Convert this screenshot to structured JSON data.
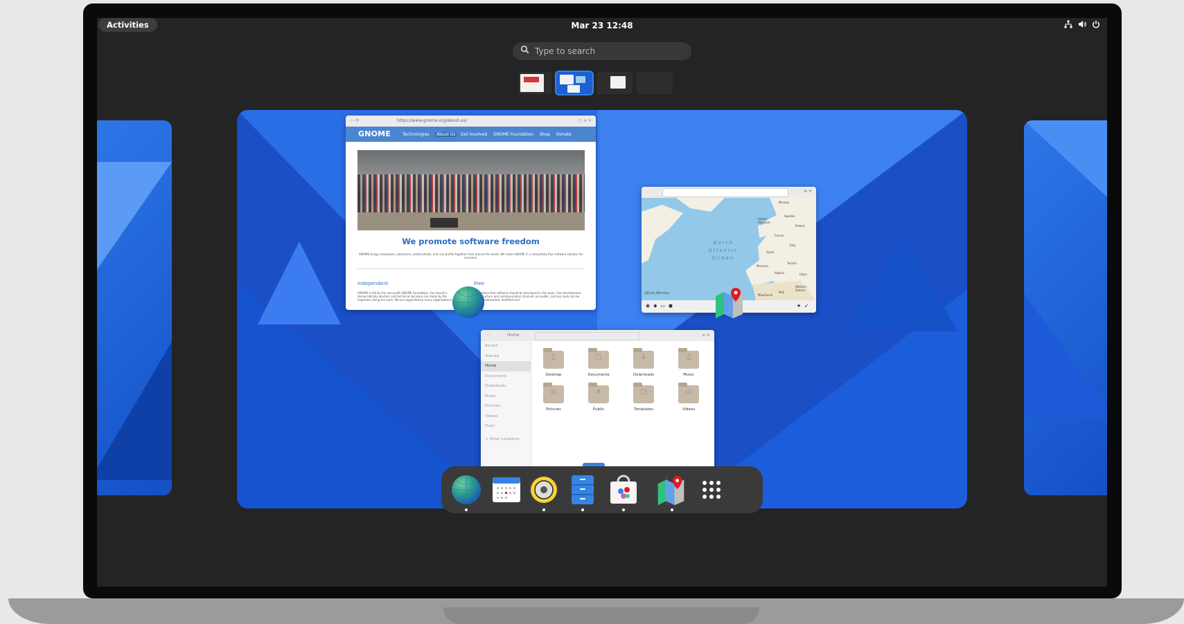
{
  "topbar": {
    "activities_label": "Activities",
    "clock": "Mar 23  12:48",
    "tray_icons": [
      "network-icon",
      "volume-icon",
      "power-icon"
    ]
  },
  "search": {
    "placeholder": "Type to search"
  },
  "workspaces": {
    "count": 4,
    "active_index": 1
  },
  "windows": {
    "web": {
      "url": "https://www.gnome.org/about-us/",
      "brand": "GNOME",
      "nav": [
        "Technologies",
        "About Us",
        "Get Involved",
        "GNOME Foundation",
        "Shop",
        "Donate"
      ],
      "headline": "We promote software freedom",
      "intro": "GNOME brings companies, volunteers, professionals, and non-profits together from around the world. We make GNOME 3: a completely free software solution for everyone.",
      "col1_title": "Independent",
      "col2_title": "Free",
      "col1_text": "GNOME is led by the non-profit GNOME Foundation. Our board is democratically elected, and technical decisions are made by the engineers doing the work. We are supported by many organizations,",
      "col2_text": "We believe that software should be developed in the open. Our development infrastructure and communication channels are public, and our code can be freely downloaded, modified and"
    },
    "maps": {
      "labels": [
        "North Atlantic Ocean",
        "Norway",
        "Sweden",
        "United Kingdom",
        "Poland",
        "France",
        "Spain",
        "Italy",
        "Morocco",
        "Algeria",
        "Tunisia",
        "Mali",
        "Mauritania",
        "Libya",
        "Western Sahara"
      ],
      "scale": "200 km   400 miles"
    },
    "files": {
      "location": "Home",
      "sidebar": [
        "Recent",
        "Starred",
        "Home",
        "Documents",
        "Downloads",
        "Music",
        "Pictures",
        "Videos",
        "Trash",
        "+ Other Locations"
      ],
      "selected_sidebar": "Home",
      "folders": [
        "Desktop",
        "Documents",
        "Downloads",
        "Music",
        "Pictures",
        "Public",
        "Templates",
        "Videos"
      ]
    }
  },
  "dock": {
    "apps": [
      {
        "name": "web-browser",
        "running": true
      },
      {
        "name": "calendar",
        "running": false
      },
      {
        "name": "rhythmbox",
        "running": true
      },
      {
        "name": "files",
        "running": true
      },
      {
        "name": "software",
        "running": true
      },
      {
        "name": "maps",
        "running": true
      },
      {
        "name": "show-apps",
        "running": false
      }
    ]
  },
  "colors": {
    "accent": "#3584e4",
    "wallpaper": "#1a4fc5",
    "panel": "#242424"
  }
}
